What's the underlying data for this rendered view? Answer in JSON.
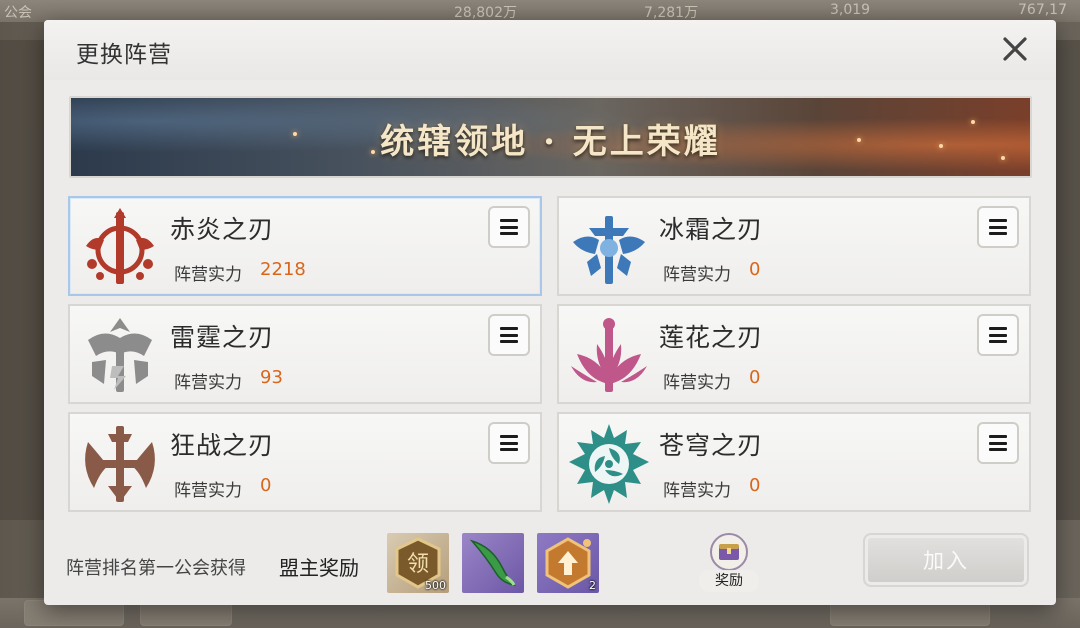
{
  "background": {
    "top_items": [
      "公会",
      "28,802万",
      "7,281万",
      "3,019",
      "767,17"
    ]
  },
  "dialog": {
    "title": "更换阵营",
    "banner_text": "统辖领地 · 无上荣耀"
  },
  "factions": [
    {
      "name": "赤炎之刃",
      "power_label": "阵营实力",
      "power": "2218",
      "selected": true,
      "color": "#b23a2a",
      "icon": "crimson-blade-emblem-icon"
    },
    {
      "name": "冰霜之刃",
      "power_label": "阵营实力",
      "power": "0",
      "selected": false,
      "color": "#3d78b8",
      "icon": "frost-blade-emblem-icon"
    },
    {
      "name": "雷霆之刃",
      "power_label": "阵营实力",
      "power": "93",
      "selected": false,
      "color": "#8c8c8c",
      "icon": "thunder-blade-emblem-icon"
    },
    {
      "name": "莲花之刃",
      "power_label": "阵营实力",
      "power": "0",
      "selected": false,
      "color": "#c0578a",
      "icon": "lotus-blade-emblem-icon"
    },
    {
      "name": "狂战之刃",
      "power_label": "阵营实力",
      "power": "0",
      "selected": false,
      "color": "#8a5a48",
      "icon": "berserk-blade-emblem-icon"
    },
    {
      "name": "苍穹之刃",
      "power_label": "阵营实力",
      "power": "0",
      "selected": false,
      "color": "#2e8f88",
      "icon": "sky-blade-emblem-icon"
    }
  ],
  "footer": {
    "text": "阵营排名第一公会获得",
    "highlight": "盟主奖励",
    "rewards": [
      {
        "icon": "lord-token-icon",
        "glyph": "领",
        "qty": "500"
      },
      {
        "icon": "jade-horn-icon",
        "qty": ""
      },
      {
        "icon": "rank-badge-icon",
        "qty": "2"
      }
    ],
    "reward_button_label": "奖励",
    "join_label": "加入"
  }
}
